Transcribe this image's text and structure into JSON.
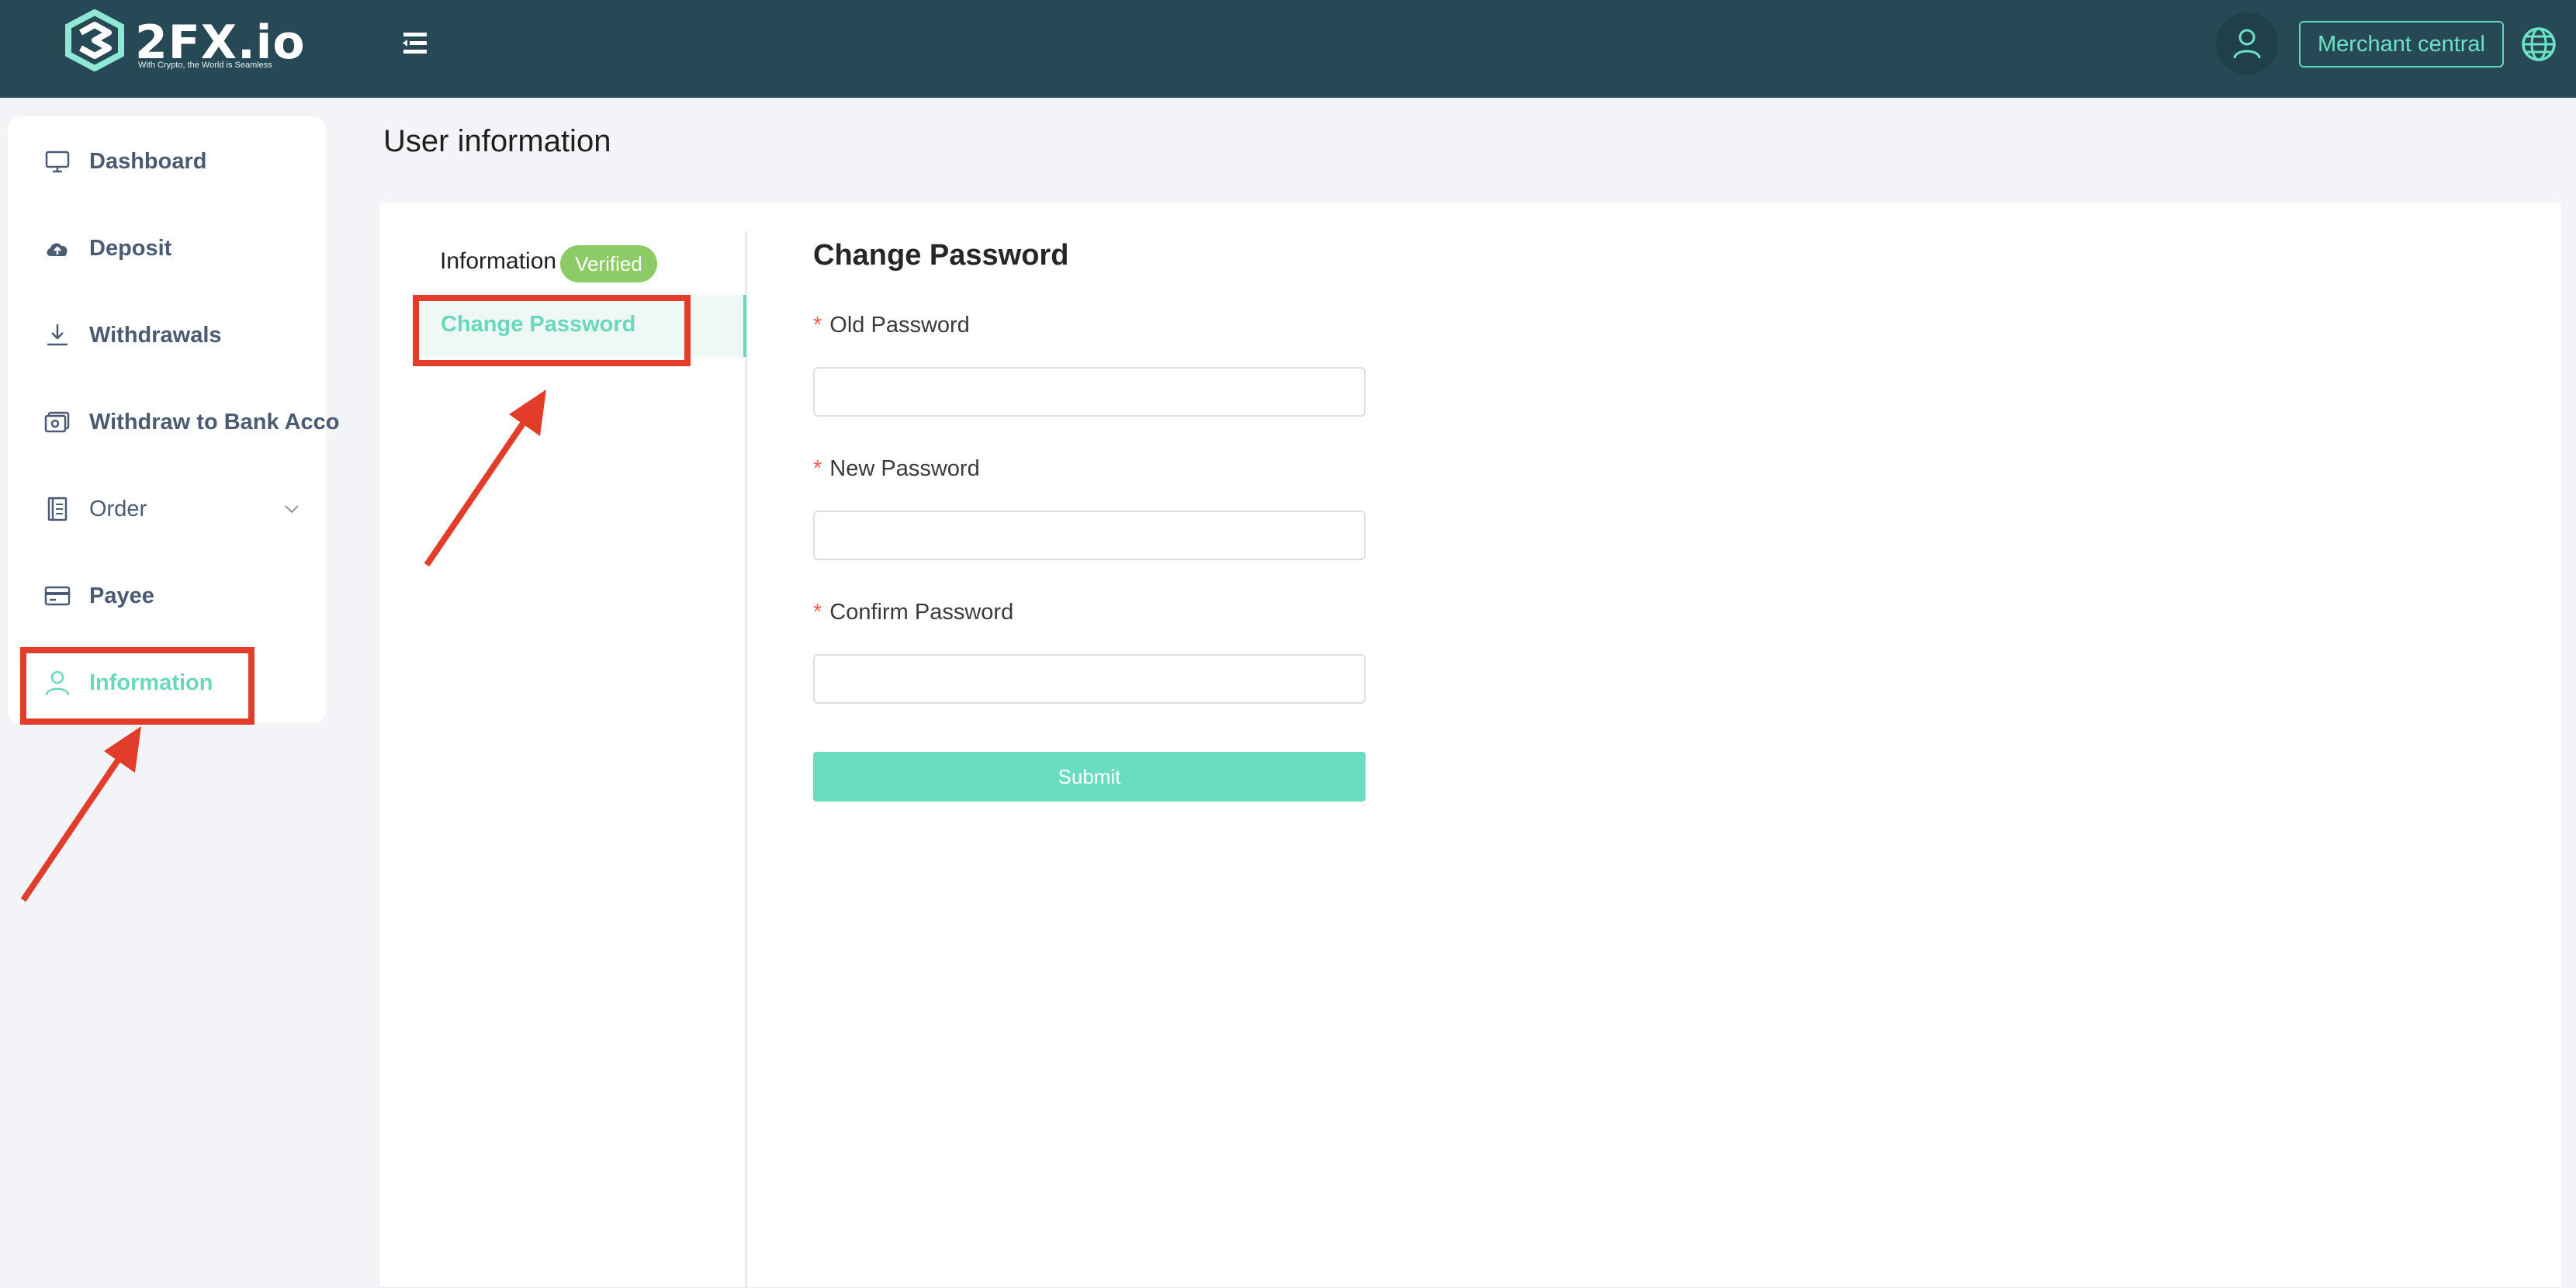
{
  "app": {
    "logo_text": "2FX.io",
    "logo_tagline": "With Crypto, the World is Seamless",
    "accent_color": "#6ad8bd",
    "header_bg": "#264955"
  },
  "header": {
    "menu_icon": "hamburger-menu-icon",
    "avatar_icon": "user-icon",
    "merchant_label": "Merchant central",
    "language_icon": "globe-icon"
  },
  "sidebar": {
    "items": [
      {
        "label": "Dashboard",
        "icon": "monitor-icon"
      },
      {
        "label": "Deposit",
        "icon": "cloud-upload-icon"
      },
      {
        "label": "Withdrawals",
        "icon": "download-icon"
      },
      {
        "label": "Withdraw to Bank Acco",
        "icon": "bank-card-icon"
      },
      {
        "label": "Order",
        "icon": "document-list-icon"
      },
      {
        "label": "Payee",
        "icon": "credit-card-icon"
      },
      {
        "label": "Information",
        "icon": "user-icon"
      }
    ],
    "active": "Information"
  },
  "page": {
    "title": "User information"
  },
  "tabs": {
    "information_label": "Information",
    "verified_badge": "Verified",
    "change_password_label": "Change Password"
  },
  "form": {
    "title": "Change Password",
    "required_mark": "*",
    "fields": [
      {
        "label": "Old Password",
        "value": ""
      },
      {
        "label": "New Password",
        "value": ""
      },
      {
        "label": "Confirm Password",
        "value": ""
      }
    ],
    "submit_label": "Submit"
  },
  "annotations": {
    "highlight_color": "#e23d2b"
  }
}
